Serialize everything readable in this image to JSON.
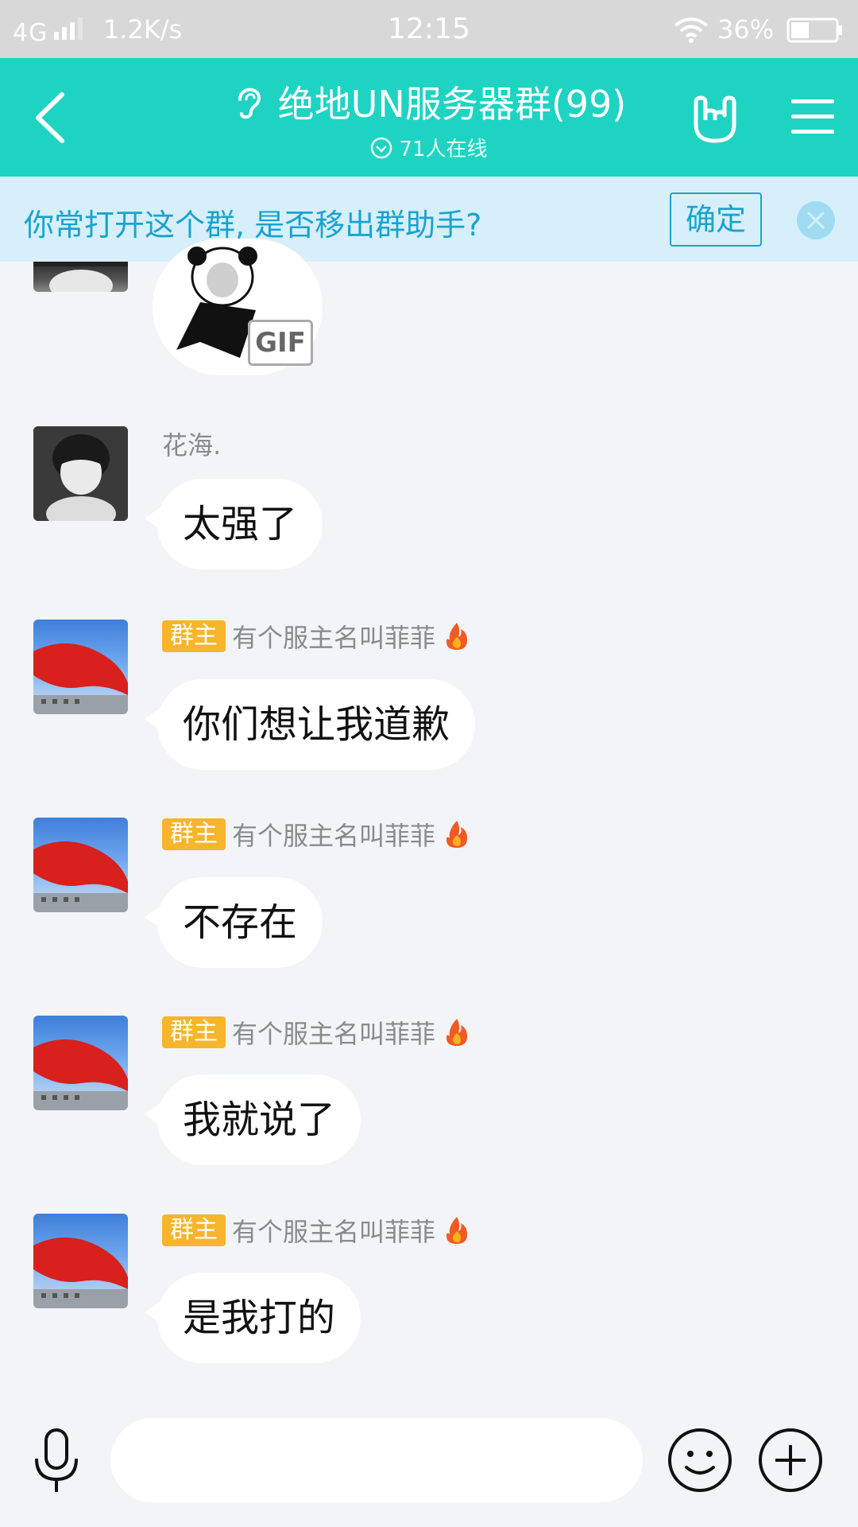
{
  "status_bar": {
    "network": "4G",
    "speed": "1.2K/s",
    "time": "12:15",
    "battery": "36%"
  },
  "header": {
    "title": "绝地UN服务器群(99)",
    "online": "71人在线"
  },
  "notice": {
    "text": "你常打开这个群, 是否移出群助手?",
    "confirm_label": "确定"
  },
  "sticker": {
    "gif_label": "GIF"
  },
  "messages": [
    {
      "sender": "花海.",
      "text": "太强了"
    },
    {
      "badge": "群主",
      "sender": "有个服主名叫菲菲",
      "text": "你们想让我道歉"
    },
    {
      "badge": "群主",
      "sender": "有个服主名叫菲菲",
      "text": "不存在"
    },
    {
      "badge": "群主",
      "sender": "有个服主名叫菲菲",
      "text": "我就说了"
    },
    {
      "badge": "群主",
      "sender": "有个服主名叫菲菲",
      "text": "是我打的"
    }
  ],
  "colors": {
    "header_bg": "#1fd3c2",
    "notice_bg": "#d6effb",
    "notice_text": "#1aa3cf",
    "owner_badge": "#f7b52b",
    "chat_bg": "#f3f4f8"
  },
  "input": {
    "placeholder": ""
  }
}
